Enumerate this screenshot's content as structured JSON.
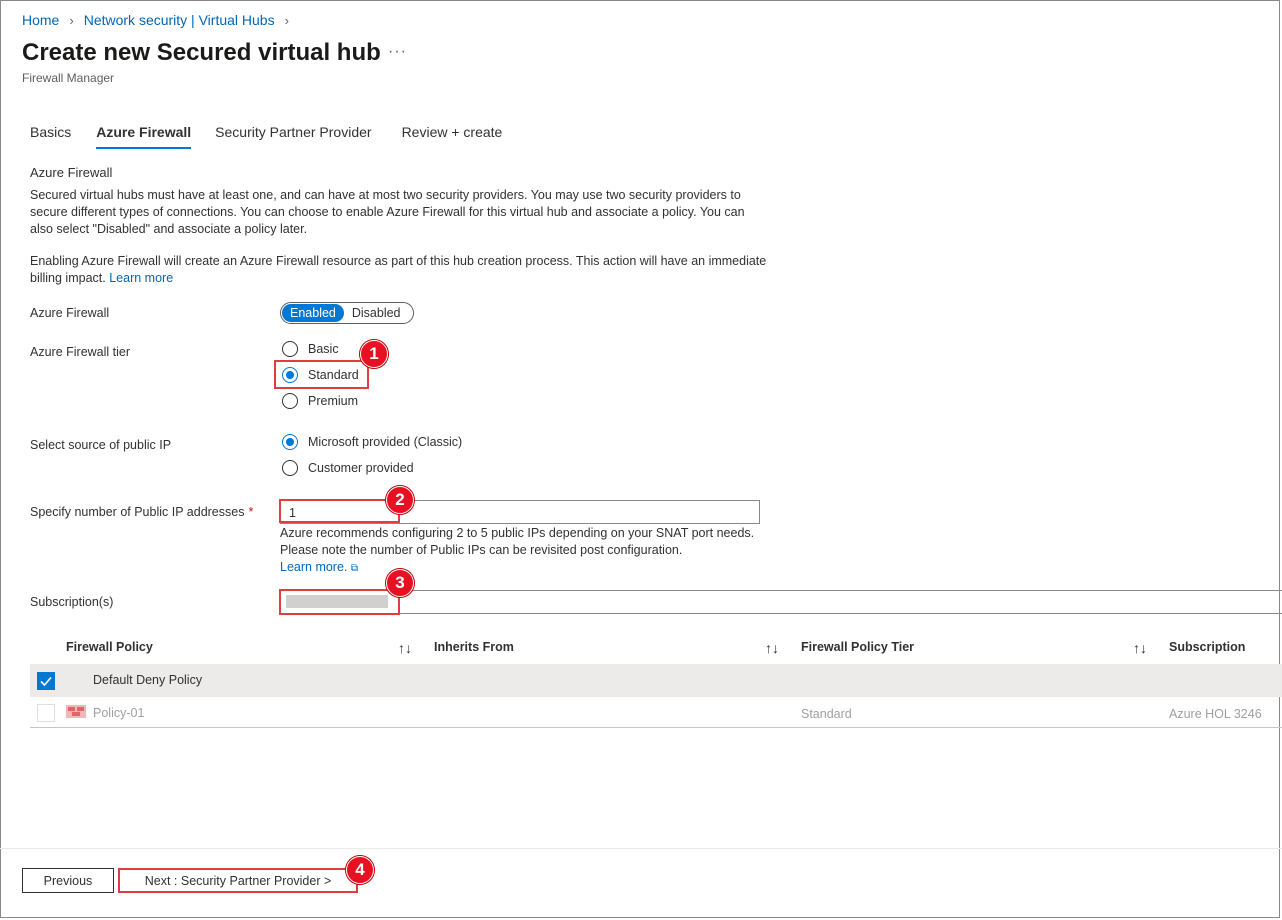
{
  "breadcrumb": {
    "home": "Home",
    "parent": "Network security | Virtual Hubs"
  },
  "header": {
    "title": "Create new Secured virtual hub",
    "more": "···",
    "subtitle": "Firewall Manager"
  },
  "tabs": [
    {
      "label": "Basics"
    },
    {
      "label": "Azure Firewall",
      "active": true
    },
    {
      "label": "Security Partner Provider"
    },
    {
      "label": "Review + create"
    }
  ],
  "section": {
    "title": "Azure Firewall",
    "para1": "Secured virtual hubs must have at least one, and can have at most two security providers. You may use two security providers to secure different types of connections. You can choose to enable Azure Firewall for this virtual hub and associate a policy. You can also select \"Disabled\" and associate a policy later.",
    "para2": "Enabling Azure Firewall will create an Azure Firewall resource as part of this hub creation process. This action will have an immediate billing impact.",
    "learn_more": "Learn more"
  },
  "firewall": {
    "label": "Azure Firewall",
    "enabled": "Enabled",
    "disabled": "Disabled"
  },
  "tier": {
    "label": "Azure Firewall tier",
    "options": [
      "Basic",
      "Standard",
      "Premium"
    ],
    "selected": "Standard"
  },
  "public_ip_source": {
    "label": "Select source of public IP",
    "options": [
      "Microsoft provided (Classic)",
      "Customer provided"
    ],
    "selected": "Microsoft provided (Classic)"
  },
  "public_ip_count": {
    "label": "Specify number of Public IP addresses",
    "required": "*",
    "value": "1",
    "help": "Azure recommends configuring 2 to 5 public IPs depending on your SNAT port needs. Please note the number of Public IPs can be revisited post configuration.",
    "learn_more": "Learn more."
  },
  "subscription": {
    "label": "Subscription(s)"
  },
  "table": {
    "headers": [
      "Firewall Policy",
      "Inherits From",
      "Firewall Policy Tier",
      "Subscription"
    ],
    "sort_icon": "↑↓",
    "rows": [
      {
        "name": "Default Deny Policy",
        "inherits": "",
        "tier": "",
        "subscription": "",
        "checked": true
      },
      {
        "name": "Policy-01",
        "inherits": "",
        "tier": "Standard",
        "subscription": "Azure HOL 3246",
        "checked": false
      }
    ]
  },
  "callouts": [
    "1",
    "2",
    "3",
    "4"
  ],
  "footer": {
    "previous": "Previous",
    "next": "Next : Security Partner Provider >"
  },
  "colors": {
    "accent": "#0078d4",
    "callout": "#e81123",
    "highlight_border": "#e03e3e"
  }
}
